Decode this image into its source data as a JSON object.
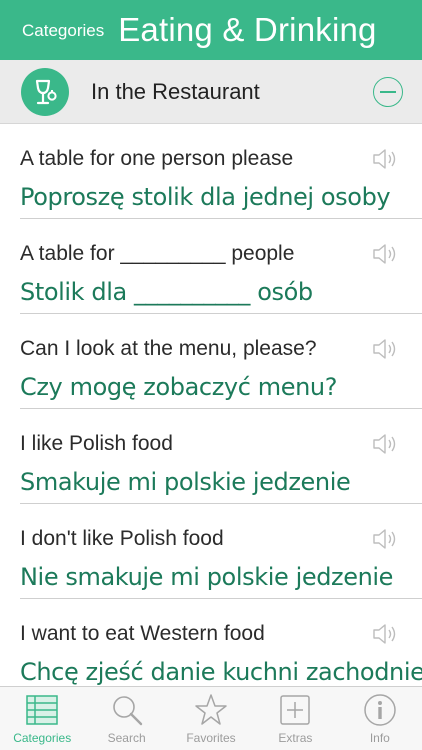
{
  "header": {
    "back_label": "Categories",
    "title": "Eating & Drinking"
  },
  "section": {
    "label": "In the Restaurant",
    "icon": "restaurant-glass-icon",
    "collapse_icon": "minus-circle-icon"
  },
  "phrases": [
    {
      "en": "A table for one person please",
      "pl": "Poproszę stolik dla jednej osoby"
    },
    {
      "en": "A table for _________ people",
      "pl": "Stolik dla __________ osób"
    },
    {
      "en": "Can I look at the menu, please?",
      "pl": "Czy mogę zobaczyć menu?"
    },
    {
      "en": "I like Polish food",
      "pl": "Smakuje mi polskie jedzenie"
    },
    {
      "en": "I don't like Polish food",
      "pl": "Nie smakuje mi polskie jedzenie"
    },
    {
      "en": "I want to eat Western food",
      "pl": "Chcę zjeść danie kuchni zachodniej"
    }
  ],
  "tabs": [
    {
      "label": "Categories",
      "icon": "list-icon",
      "active": true
    },
    {
      "label": "Search",
      "icon": "search-icon",
      "active": false
    },
    {
      "label": "Favorites",
      "icon": "star-icon",
      "active": false
    },
    {
      "label": "Extras",
      "icon": "plus-box-icon",
      "active": false
    },
    {
      "label": "Info",
      "icon": "info-icon",
      "active": false
    }
  ],
  "colors": {
    "accent": "#3ab88a",
    "phrase_text": "#1c7a5a",
    "inactive_tab": "#9c9c9c"
  }
}
